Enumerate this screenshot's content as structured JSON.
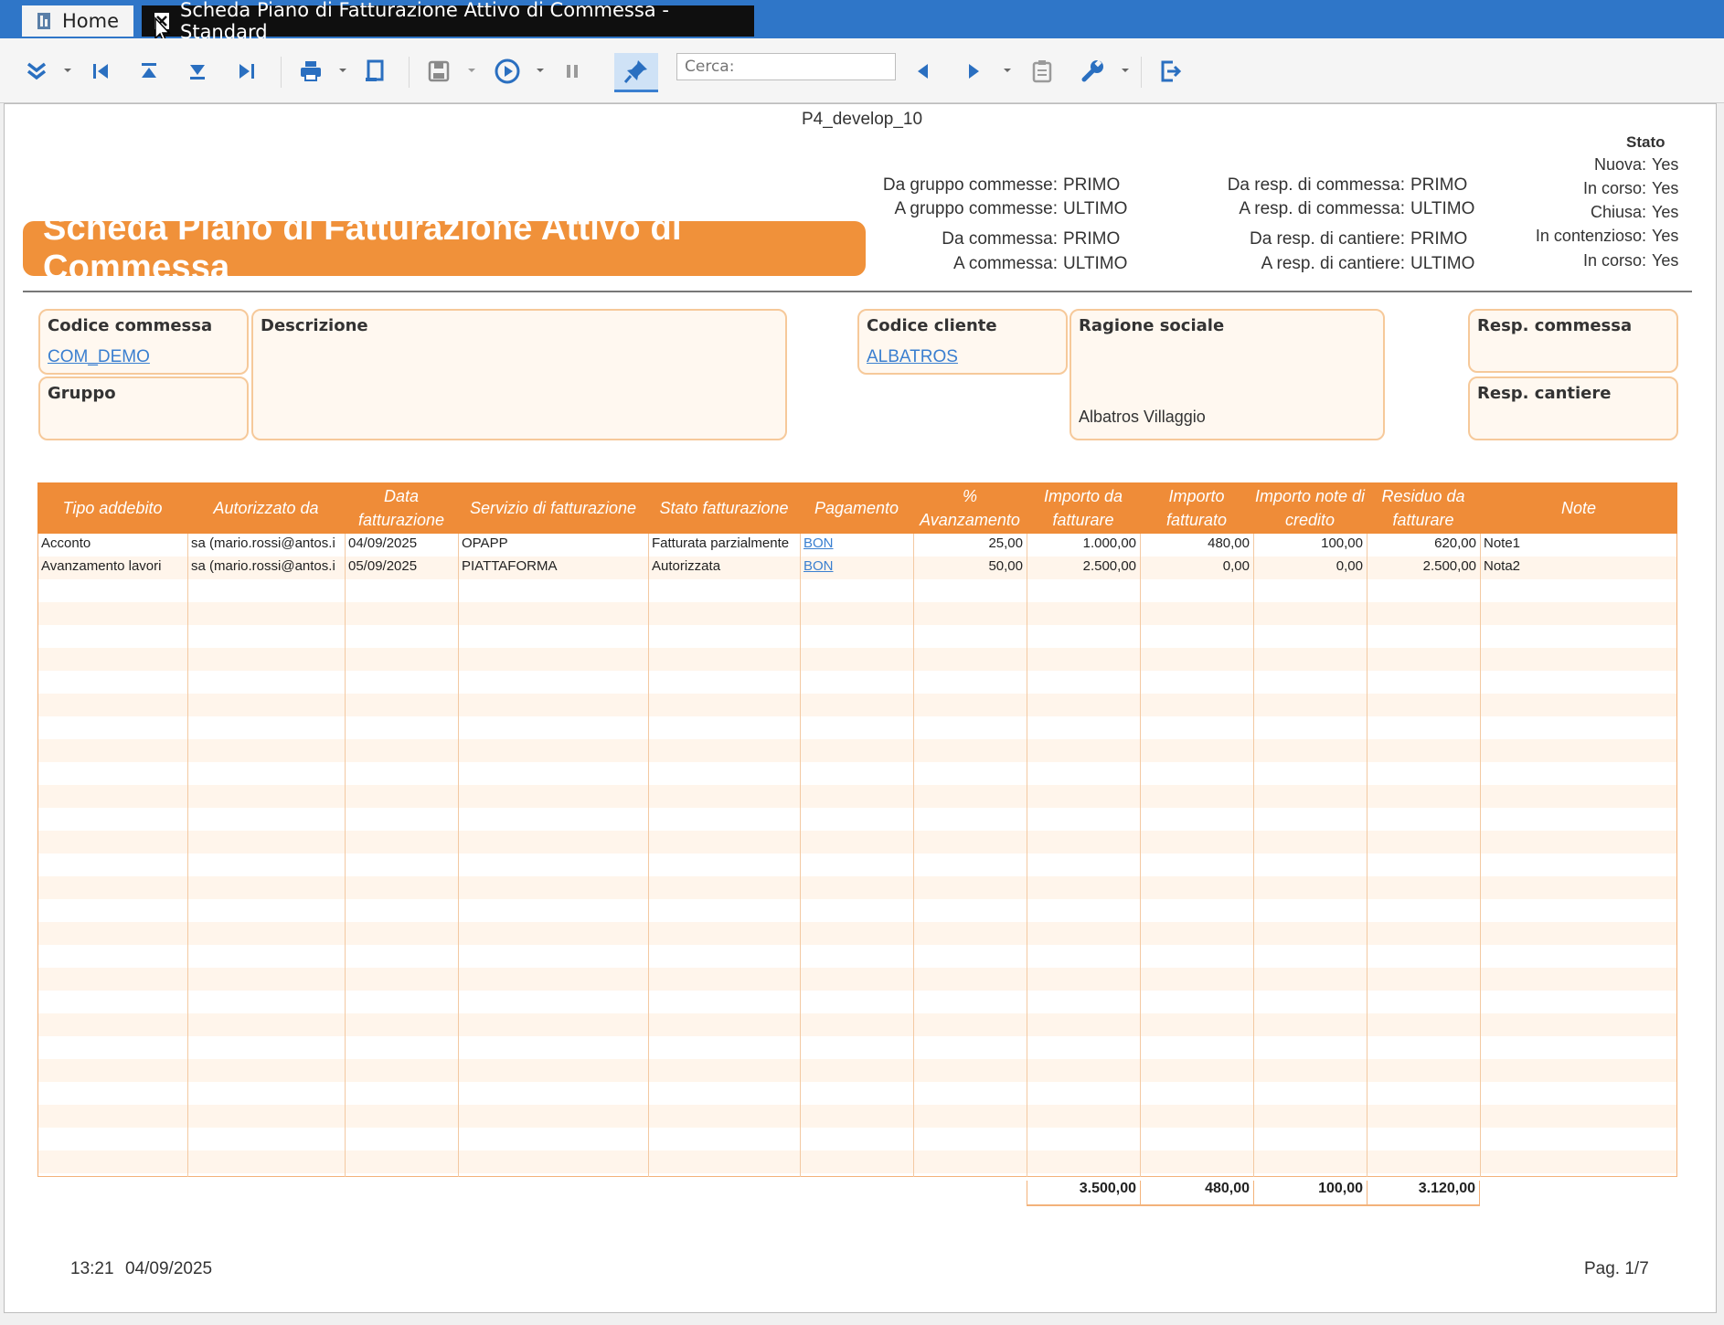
{
  "titlebar": {
    "home_tab": "Home",
    "report_tab": "Scheda Piano di Fatturazione Attivo di Commessa - Standard"
  },
  "toolbar": {
    "search_placeholder": "Cerca:",
    "icons": [
      "collapse-icon",
      "first-page-icon",
      "page-up-icon",
      "page-down-icon",
      "last-page-icon",
      "print-icon",
      "page-setup-icon",
      "save-icon",
      "play-icon",
      "pause-icon",
      "pin-icon",
      "search-prev-icon",
      "search-next-icon",
      "clipboard-icon",
      "wrench-icon",
      "exit-icon"
    ]
  },
  "report": {
    "env": "P4_develop_10",
    "title": "Scheda Piano di Fatturazione Attivo di Commessa",
    "filters": {
      "da_gruppo_label": "Da gruppo commesse:",
      "da_gruppo": "PRIMO",
      "a_gruppo_label": "A gruppo commesse:",
      "a_gruppo": "ULTIMO",
      "da_commessa_label": "Da commessa:",
      "da_commessa": "PRIMO",
      "a_commessa_label": "A commessa:",
      "a_commessa": "ULTIMO",
      "da_resp_comm_label": "Da resp. di commessa:",
      "da_resp_comm": "PRIMO",
      "a_resp_comm_label": "A resp. di commessa:",
      "a_resp_comm": "ULTIMO",
      "da_resp_cant_label": "Da resp. di cantiere:",
      "da_resp_cant": "PRIMO",
      "a_resp_cant_label": "A resp. di cantiere:",
      "a_resp_cant": "ULTIMO"
    },
    "stato": {
      "title": "Stato",
      "items": [
        {
          "label": "Nuova:",
          "value": "Yes"
        },
        {
          "label": "In corso:",
          "value": "Yes"
        },
        {
          "label": "Chiusa:",
          "value": "Yes"
        },
        {
          "label": "In contenzioso:",
          "value": "Yes"
        },
        {
          "label": "In corso:",
          "value": "Yes"
        }
      ]
    },
    "fields": {
      "codice_commessa_label": "Codice commessa",
      "codice_commessa": "COM_DEMO",
      "gruppo_label": "Gruppo",
      "descrizione_label": "Descrizione",
      "codice_cliente_label": "Codice cliente",
      "codice_cliente": "ALBATROS",
      "ragione_sociale_label": "Ragione sociale",
      "ragione_sociale": "Albatros Villaggio",
      "resp_commessa_label": "Resp. commessa",
      "resp_cantiere_label": "Resp. cantiere"
    },
    "table": {
      "headers": [
        "Tipo addebito",
        "Autorizzato da",
        "Data fatturazione",
        "Servizio di fatturazione",
        "Stato fatturazione",
        "Pagamento",
        "% Avanzamento",
        "Importo da fatturare",
        "Importo fatturato",
        "Importo note di credito",
        "Residuo da fatturare",
        "Note"
      ],
      "rows": [
        [
          "Acconto",
          "sa (mario.rossi@antos.i",
          "04/09/2025",
          "OPAPP",
          "Fatturata parzialmente",
          "BON",
          "25,00",
          "1.000,00",
          "480,00",
          "100,00",
          "620,00",
          "Note1"
        ],
        [
          "Avanzamento lavori",
          "sa (mario.rossi@antos.i",
          "05/09/2025",
          "PIATTAFORMA",
          "Autorizzata",
          "BON",
          "50,00",
          "2.500,00",
          "0,00",
          "0,00",
          "2.500,00",
          "Nota2"
        ]
      ],
      "totals": [
        "3.500,00",
        "480,00",
        "100,00",
        "3.120,00"
      ]
    },
    "footer": {
      "time": "13:21",
      "date": "04/09/2025",
      "page": "Pag. 1/7"
    }
  }
}
